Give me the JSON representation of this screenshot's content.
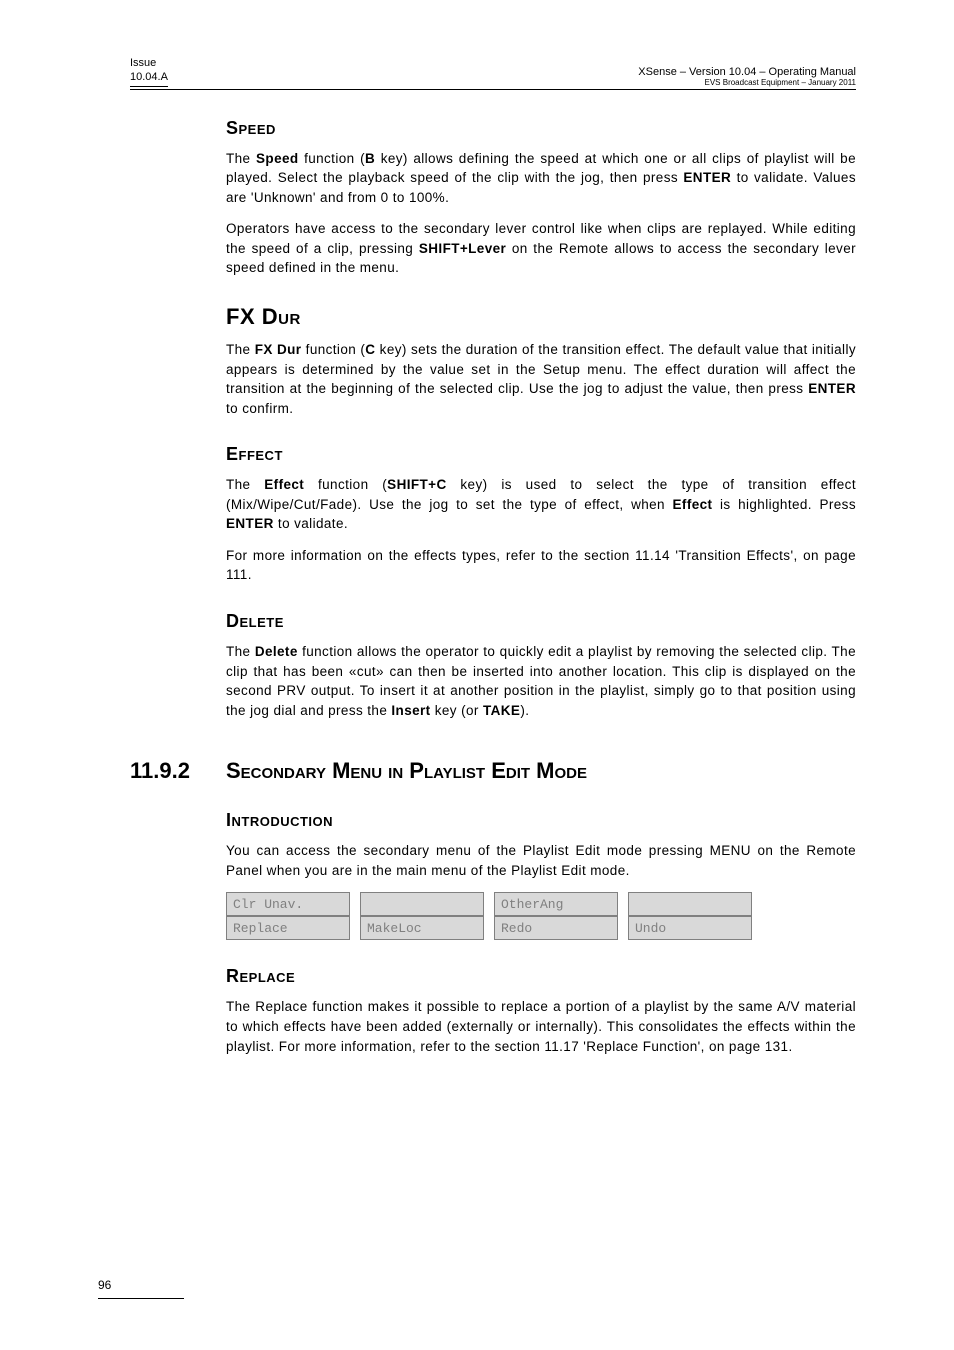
{
  "header": {
    "left_line1": "Issue",
    "left_line2": "10.04.A",
    "right_title": "XSense – Version 10.04 – Operating Manual",
    "right_sub": "EVS Broadcast Equipment  – January 2011"
  },
  "sections": {
    "speed": {
      "heading": "Speed",
      "p1_a": "The ",
      "p1_b": "Speed",
      "p1_c": " function (",
      "p1_d": "B",
      "p1_e": " key) allows defining the speed at which one or all clips of playlist will be played. Select the playback speed of the clip with the jog, then press ",
      "p1_f": "ENTER",
      "p1_g": " to validate. Values are 'Unknown' and from 0 to 100%.",
      "p2_a": "Operators have access to the secondary lever control like when clips are replayed. While editing the speed of a clip, pressing ",
      "p2_b": "SHIFT+Lever",
      "p2_c": " on the Remote allows to access the secondary lever speed defined in the menu."
    },
    "fxdur": {
      "heading": "FX Dur",
      "p1_a": "The ",
      "p1_b": "FX Dur",
      "p1_c": " function (",
      "p1_d": "C",
      "p1_e": " key) sets the duration of the transition effect. The default value that initially appears is determined by the value set in the Setup menu. The effect duration will affect the transition at the beginning of the selected clip. Use the jog to adjust the value, then press ",
      "p1_f": "ENTER",
      "p1_g": " to confirm."
    },
    "effect": {
      "heading": "Effect",
      "p1_a": "The ",
      "p1_b": "Effect",
      "p1_c": " function (",
      "p1_d": "SHIFT+C",
      "p1_e": " key) is used to select the type of transition effect (Mix/Wipe/Cut/Fade). Use the jog to set the type of effect, when ",
      "p1_f": "Effect",
      "p1_g": " is highlighted. Press ",
      "p1_h": "ENTER",
      "p1_i": " to validate.",
      "p2": "For more information on the effects types, refer to the section 11.14 'Transition Effects', on page 111."
    },
    "delete": {
      "heading": "Delete",
      "p1_a": "The ",
      "p1_b": "Delete",
      "p1_c": " function allows the operator to quickly edit a playlist by removing the selected clip. The clip that has been «cut» can then be inserted into another location. This clip is displayed on the second PRV output. To insert it at another position in the playlist, simply go to that position using the jog dial and press the ",
      "p1_d": "Insert",
      "p1_e": " key (or ",
      "p1_f": "TAKE",
      "p1_g": ")."
    },
    "secondary": {
      "number": "11.9.2",
      "heading": "Secondary Menu in Playlist Edit Mode"
    },
    "introduction": {
      "heading": "Introduction",
      "p1": "You can access the secondary menu of the Playlist Edit mode pressing MENU on the Remote Panel when you are in the main menu of the Playlist Edit mode.",
      "table": {
        "r1c1": "Clr Unav.",
        "r1c2": "",
        "r1c3": "OtherAng",
        "r1c4": "",
        "r2c1": "Replace",
        "r2c2": "MakeLoc",
        "r2c3": "Redo",
        "r2c4": "Undo"
      }
    },
    "replace": {
      "heading": "Replace",
      "p1": "The Replace function makes it possible to replace a portion of a playlist by the same A/V material to which effects have been added (externally or internally). This consolidates the effects within the playlist. For more information, refer to the section 11.17 'Replace Function', on page 131."
    }
  },
  "footer": {
    "page_number": "96"
  }
}
